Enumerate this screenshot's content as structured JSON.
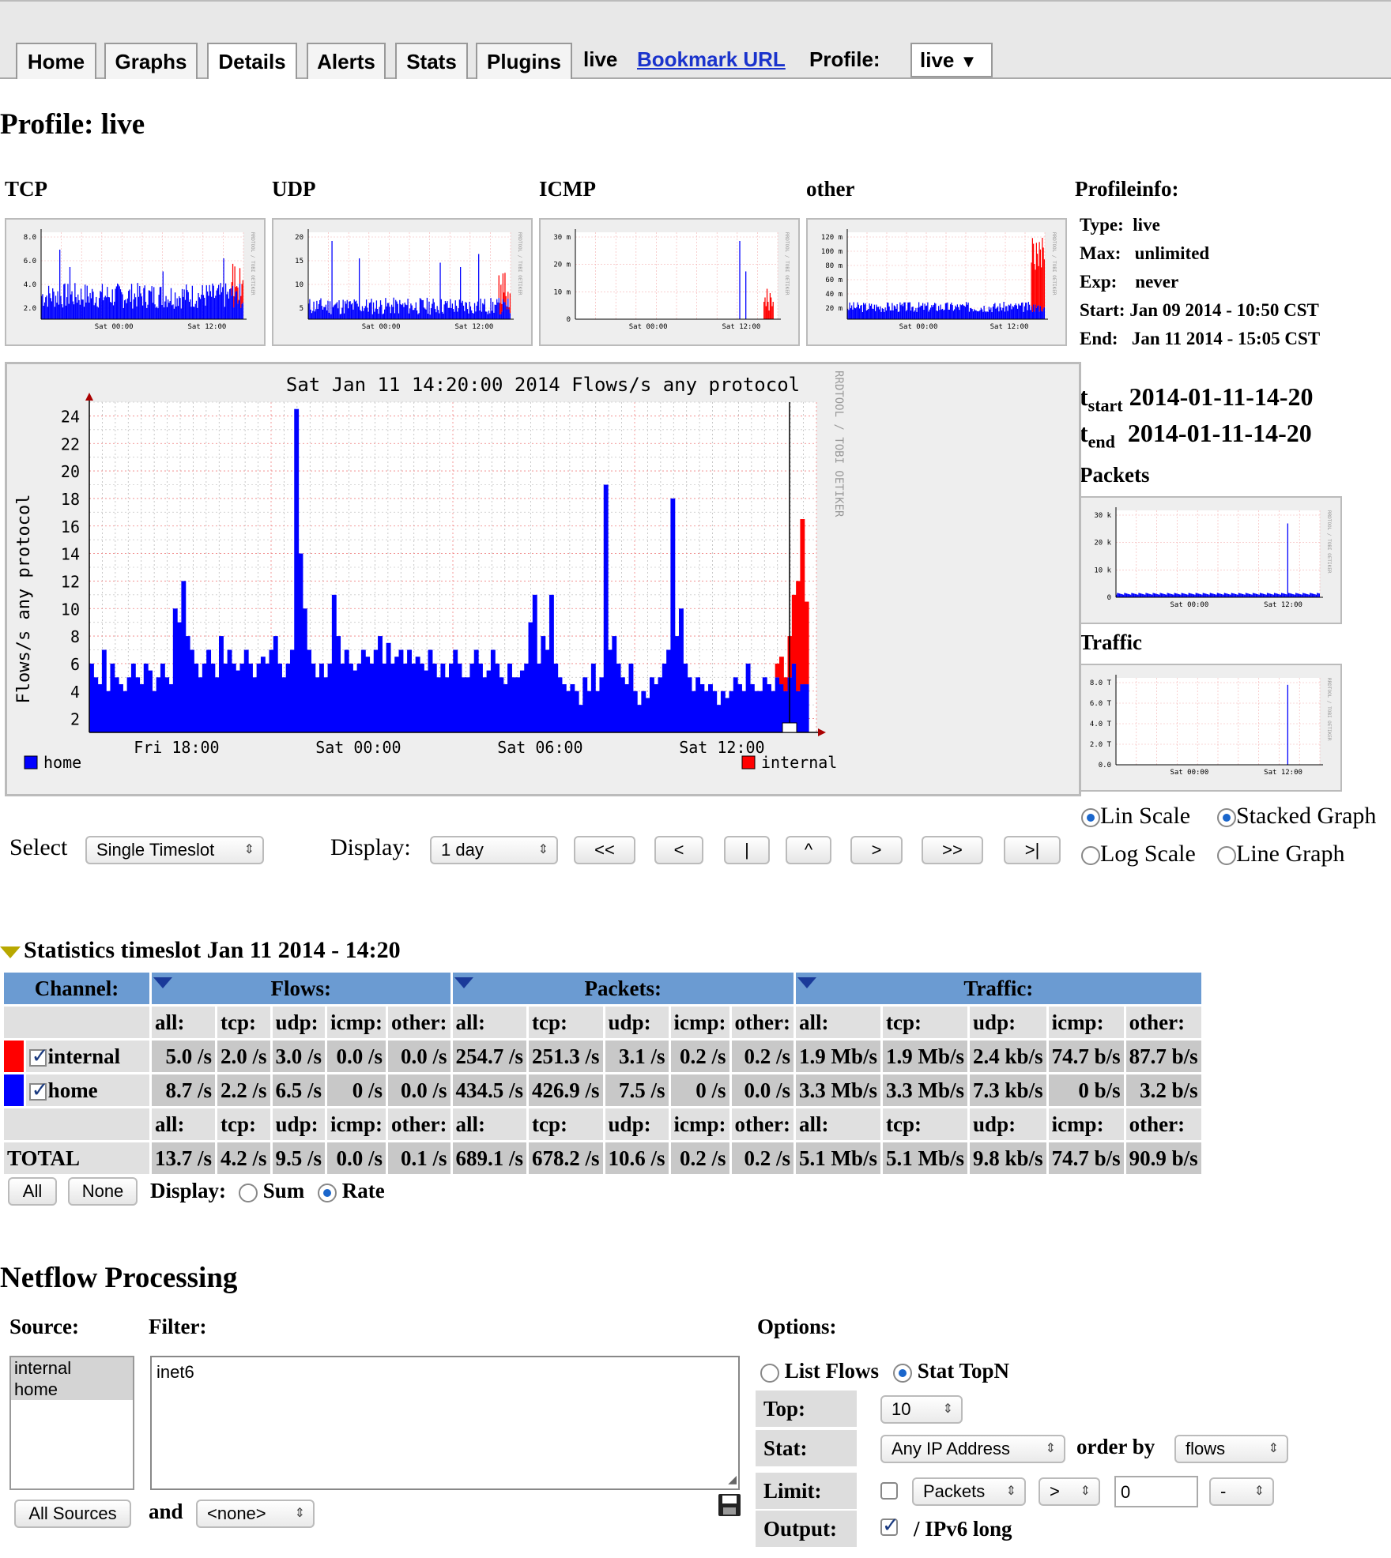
{
  "nav": {
    "tabs": [
      "Home",
      "Graphs",
      "Details",
      "Alerts",
      "Stats",
      "Plugins"
    ],
    "active": "Details",
    "profile_text": "live",
    "bookmark": "Bookmark URL",
    "profile_label": "Profile:",
    "profile_value": "live"
  },
  "page_title": "Profile: live",
  "thumbs": [
    {
      "title": "TCP",
      "yticks": [
        "8.0",
        "6.0",
        "4.0",
        "2.0"
      ],
      "xticks": [
        "Sat 00:00",
        "Sat 12:00"
      ],
      "side": "RRDTOOL / TOBI OETIKER"
    },
    {
      "title": "UDP",
      "yticks": [
        "20",
        "15",
        "10",
        "5"
      ],
      "xticks": [
        "Sat 00:00",
        "Sat 12:00"
      ],
      "side": "RRDTOOL / TOBI OETIKER"
    },
    {
      "title": "ICMP",
      "yticks": [
        "30 m",
        "20 m",
        "10 m",
        "0"
      ],
      "xticks": [
        "Sat 00:00",
        "Sat 12:00"
      ],
      "side": "RRDTOOL / TOBI OETIKER"
    },
    {
      "title": "other",
      "yticks": [
        "120 m",
        "100 m",
        "80 m",
        "60 m",
        "40 m",
        "20 m"
      ],
      "xticks": [
        "Sat 00:00",
        "Sat 12:00"
      ],
      "side": "RRDTOOL / TOBI OETIKER"
    }
  ],
  "profileinfo": {
    "title": "Profileinfo:",
    "rows": [
      {
        "k": "Type:",
        "v": "live"
      },
      {
        "k": "Max:",
        "v": "unlimited"
      },
      {
        "k": "Exp:",
        "v": "never"
      },
      {
        "k": "Start:",
        "v": "Jan 09 2014 - 10:50 CST"
      },
      {
        "k": "End:",
        "v": "Jan 11 2014 - 15:05 CST"
      }
    ],
    "tstart_label": "t",
    "tstart_sub": "start",
    "tstart": "2014-01-11-14-20",
    "tend_label": "t",
    "tend_sub": "end",
    "tend": "2014-01-11-14-20"
  },
  "side_graphs": [
    {
      "title": "Packets",
      "yticks": [
        "30 k",
        "20 k",
        "10 k",
        "0"
      ],
      "xticks": [
        "Sat 00:00",
        "Sat 12:00"
      ]
    },
    {
      "title": "Traffic",
      "yticks": [
        "8.0 T",
        "6.0 T",
        "4.0 T",
        "2.0 T",
        "0.0"
      ],
      "xticks": [
        "Sat 00:00",
        "Sat 12:00"
      ]
    }
  ],
  "chart_data": {
    "type": "area",
    "title": "Sat Jan 11 14:20:00 2014 Flows/s any protocol",
    "ylabel": "Flows/s any protocol",
    "xlabel": "",
    "ylim": [
      1,
      25
    ],
    "yticks": [
      2,
      4,
      6,
      8,
      10,
      12,
      14,
      16,
      18,
      20,
      22,
      24
    ],
    "xticks": [
      "Fri 18:00",
      "Sat 00:00",
      "Sat 06:00",
      "Sat 12:00"
    ],
    "watermark": "RRDTOOL / TOBI OETIKER",
    "grid": true,
    "legend": [
      {
        "name": "home",
        "color": "#0000ff",
        "position": "bottom-left"
      },
      {
        "name": "internal",
        "color": "#ff0000",
        "position": "bottom-right"
      }
    ],
    "series": [
      {
        "name": "home",
        "color": "#0000ff",
        "values": [
          6,
          5,
          4.5,
          7,
          4,
          6,
          5,
          4.5,
          4,
          5,
          6,
          5,
          4.5,
          6,
          5.5,
          4,
          5,
          6,
          5,
          4.5,
          10,
          9,
          12,
          8,
          7,
          6,
          5,
          6,
          7,
          6,
          5,
          8,
          6,
          7,
          6,
          5.5,
          6,
          7,
          6,
          5,
          6,
          6.5,
          6,
          7,
          8,
          6,
          5,
          6,
          7,
          24.5,
          14,
          10,
          7,
          6,
          5,
          6,
          5,
          6,
          11,
          8,
          6,
          7,
          6,
          5.5,
          6,
          7,
          6.5,
          6,
          7,
          8,
          6,
          7.5,
          6,
          6.5,
          7,
          6,
          7,
          6,
          6.5,
          6,
          5.5,
          7,
          6,
          5,
          6,
          5,
          6,
          7,
          6,
          5,
          5,
          6,
          7,
          6,
          5,
          5.5,
          7,
          6,
          5,
          4.5,
          6,
          5,
          5,
          5.5,
          6,
          9,
          11,
          6,
          8,
          7,
          11,
          6,
          5,
          4.5,
          4,
          4.5,
          4,
          3,
          5,
          4,
          6,
          4,
          5,
          19,
          7,
          8,
          6,
          5,
          4.5,
          6,
          4,
          3,
          4,
          3.5,
          5,
          4.5,
          5,
          6,
          7,
          18,
          8,
          10,
          6,
          5,
          4,
          5,
          4.5,
          4,
          4.5,
          4,
          3,
          4,
          3.5,
          4,
          5,
          4.5,
          4,
          6,
          4.5,
          4,
          4,
          5,
          4.5,
          4,
          5,
          4.5,
          4,
          5,
          6,
          4,
          4.5,
          4.5
        ],
        "note_unit": "flows/s"
      },
      {
        "name": "internal",
        "color": "#ff0000",
        "values": [
          0,
          0,
          0,
          0,
          0,
          0,
          0,
          0,
          0,
          0,
          0,
          0,
          0,
          0,
          0,
          0,
          0,
          0,
          0,
          0,
          0,
          0,
          0,
          0,
          0,
          0,
          0,
          0,
          0,
          0,
          0,
          0,
          0,
          0,
          0,
          0,
          0,
          0,
          0,
          0,
          0,
          0,
          0,
          0,
          0,
          0,
          0,
          0,
          0,
          0,
          0,
          0,
          0,
          0,
          0,
          0,
          0,
          0,
          0,
          0,
          0,
          0,
          0,
          0,
          0,
          0,
          0,
          0,
          0,
          0,
          0,
          0,
          0,
          0,
          0,
          0,
          0,
          0,
          0,
          0,
          0,
          0,
          0,
          0,
          0,
          0,
          0,
          0,
          0,
          0,
          0,
          0,
          0,
          0,
          0,
          0,
          0,
          0,
          0,
          0,
          0,
          0,
          0,
          0,
          0,
          0,
          0,
          0,
          0,
          0,
          0,
          0,
          0,
          0,
          0,
          0,
          0,
          0,
          0,
          0,
          0,
          0,
          0,
          0,
          0,
          0,
          0,
          0,
          0,
          0,
          0,
          0,
          0,
          0,
          0,
          0,
          0,
          0,
          0,
          0,
          0,
          0,
          0,
          0,
          0,
          0,
          0,
          0,
          0,
          0,
          0,
          0,
          0,
          0,
          0,
          0,
          0,
          0,
          0,
          0,
          0,
          0,
          0,
          0,
          1,
          2,
          1,
          3,
          5,
          8,
          12,
          6,
          4,
          7,
          3,
          2,
          1
        ],
        "note_unit": "flows/s"
      }
    ]
  },
  "scale": {
    "lin": "Lin Scale",
    "log": "Log Scale",
    "stacked": "Stacked Graph",
    "line": "Line Graph"
  },
  "controls": {
    "select_label": "Select",
    "select_value": "Single Timeslot",
    "display_label": "Display:",
    "display_value": "1 day",
    "nav_buttons": [
      "<<",
      "<",
      "|",
      "^",
      ">",
      ">>",
      ">|"
    ]
  },
  "stats": {
    "title": "Statistics timeslot Jan 11 2014 - 14:20",
    "channel_label": "Channel:",
    "groups": [
      "Flows:",
      "Packets:",
      "Traffic:"
    ],
    "subheaders": [
      "all:",
      "tcp:",
      "udp:",
      "icmp:",
      "other:",
      "all:",
      "tcp:",
      "udp:",
      "icmp:",
      "other:",
      "all:",
      "tcp:",
      "udp:",
      "icmp:",
      "other:"
    ],
    "rows": [
      {
        "name": "internal",
        "color": "#ff0000",
        "checked": true,
        "values": [
          "5.0 /s",
          "2.0 /s",
          "3.0 /s",
          "0.0 /s",
          "0.0 /s",
          "254.7 /s",
          "251.3 /s",
          "3.1 /s",
          "0.2 /s",
          "0.2 /s",
          "1.9 Mb/s",
          "1.9 Mb/s",
          "2.4 kb/s",
          "74.7 b/s",
          "87.7 b/s"
        ]
      },
      {
        "name": "home",
        "color": "#0000ff",
        "checked": true,
        "values": [
          "8.7 /s",
          "2.2 /s",
          "6.5 /s",
          "0 /s",
          "0.0 /s",
          "434.5 /s",
          "426.9 /s",
          "7.5 /s",
          "0 /s",
          "0.0 /s",
          "3.3 Mb/s",
          "3.3 Mb/s",
          "7.3 kb/s",
          "0 b/s",
          "3.2 b/s"
        ]
      }
    ],
    "total_label": "TOTAL",
    "total_values": [
      "13.7 /s",
      "4.2 /s",
      "9.5 /s",
      "0.0 /s",
      "0.1 /s",
      "689.1 /s",
      "678.2 /s",
      "10.6 /s",
      "0.2 /s",
      "0.2 /s",
      "5.1 Mb/s",
      "5.1 Mb/s",
      "9.8 kb/s",
      "74.7 b/s",
      "90.9 b/s"
    ],
    "all_btn": "All",
    "none_btn": "None",
    "display_label": "Display:",
    "sum_label": "Sum",
    "rate_label": "Rate"
  },
  "netflow": {
    "title": "Netflow Processing",
    "source_label": "Source:",
    "filter_label": "Filter:",
    "options_label": "Options:",
    "sources": [
      "internal",
      "home"
    ],
    "filter_text": "inet6",
    "all_sources": "All Sources",
    "and_label": "and",
    "and_value": "<none>",
    "list_flows": "List Flows",
    "stat_topn": "Stat TopN",
    "top_label": "Top:",
    "top_value": "10",
    "stat_label": "Stat:",
    "stat_value": "Any IP Address",
    "orderby_label": "order by",
    "orderby_value": "flows",
    "limit_label": "Limit:",
    "limit_what": "Packets",
    "limit_op": ">",
    "limit_value": "0",
    "limit_unit": "-",
    "output_label": "Output:",
    "output_value": "/ IPv6 long"
  }
}
